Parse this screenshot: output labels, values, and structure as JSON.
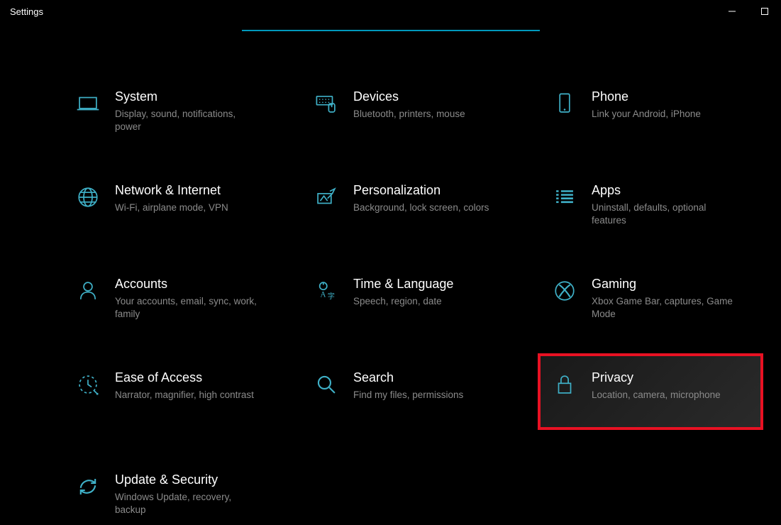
{
  "window": {
    "title": "Settings"
  },
  "categories": [
    {
      "id": "system",
      "title": "System",
      "desc": "Display, sound, notifications, power",
      "icon": "laptop-icon",
      "highlight": false
    },
    {
      "id": "devices",
      "title": "Devices",
      "desc": "Bluetooth, printers, mouse",
      "icon": "keyboard-icon",
      "highlight": false
    },
    {
      "id": "phone",
      "title": "Phone",
      "desc": "Link your Android, iPhone",
      "icon": "phone-icon",
      "highlight": false
    },
    {
      "id": "network",
      "title": "Network & Internet",
      "desc": "Wi-Fi, airplane mode, VPN",
      "icon": "globe-icon",
      "highlight": false
    },
    {
      "id": "personalization",
      "title": "Personalization",
      "desc": "Background, lock screen, colors",
      "icon": "paint-icon",
      "highlight": false
    },
    {
      "id": "apps",
      "title": "Apps",
      "desc": "Uninstall, defaults, optional features",
      "icon": "apps-icon",
      "highlight": false
    },
    {
      "id": "accounts",
      "title": "Accounts",
      "desc": "Your accounts, email, sync, work, family",
      "icon": "person-icon",
      "highlight": false
    },
    {
      "id": "time",
      "title": "Time & Language",
      "desc": "Speech, region, date",
      "icon": "language-icon",
      "highlight": false
    },
    {
      "id": "gaming",
      "title": "Gaming",
      "desc": "Xbox Game Bar, captures, Game Mode",
      "icon": "xbox-icon",
      "highlight": false
    },
    {
      "id": "ease",
      "title": "Ease of Access",
      "desc": "Narrator, magnifier, high contrast",
      "icon": "ease-icon",
      "highlight": false
    },
    {
      "id": "search",
      "title": "Search",
      "desc": "Find my files, permissions",
      "icon": "search-icon",
      "highlight": false
    },
    {
      "id": "privacy",
      "title": "Privacy",
      "desc": "Location, camera, microphone",
      "icon": "lock-icon",
      "highlight": true
    },
    {
      "id": "update",
      "title": "Update & Security",
      "desc": "Windows Update, recovery, backup",
      "icon": "update-icon",
      "highlight": false
    }
  ]
}
